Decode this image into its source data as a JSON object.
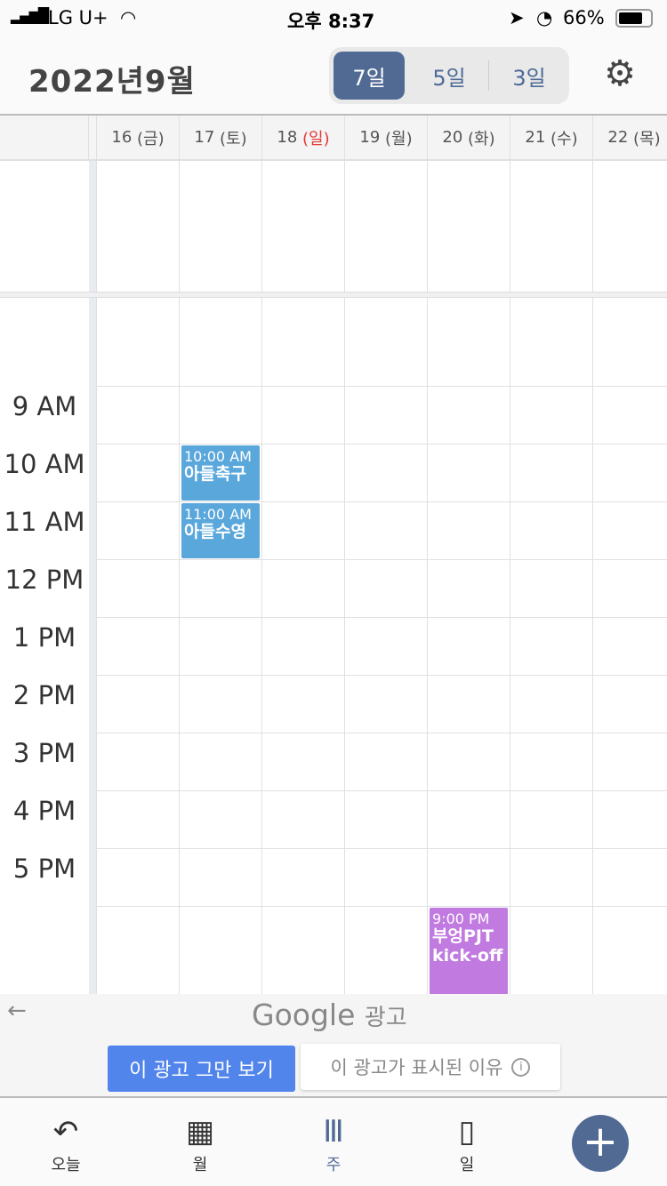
{
  "status_bar": {
    "carrier": "LG U+",
    "time": "오후 8:37",
    "battery": "66%"
  },
  "header": {
    "title": "2022년9월",
    "segments": [
      "7일",
      "5일",
      "3일"
    ],
    "active_segment": "7일",
    "settings_icon": "gear-icon"
  },
  "days": [
    {
      "num": "16",
      "wd": "(금)"
    },
    {
      "num": "17",
      "wd": "(토)"
    },
    {
      "num": "18",
      "wd": "(일)",
      "holiday": true
    },
    {
      "num": "19",
      "wd": "(월)"
    },
    {
      "num": "20",
      "wd": "(화)"
    },
    {
      "num": "21",
      "wd": "(수)"
    },
    {
      "num": "22",
      "wd": "(목)"
    }
  ],
  "time_labels": [
    "9 AM",
    "10 AM",
    "11 AM",
    "12 PM",
    "1 PM",
    "2 PM",
    "3 PM",
    "4 PM",
    "5 PM"
  ],
  "events": [
    {
      "time": "10:00 AM",
      "title": "아들축구",
      "color": "#5aa7dc"
    },
    {
      "time": "11:00 AM",
      "title": "아들수영",
      "color": "#5aa7dc"
    },
    {
      "time": "9:00 PM",
      "title": "부엉PJT kick-off",
      "color": "#c07ae0"
    }
  ],
  "ad": {
    "brand": "Google",
    "label": "광고",
    "stop_button": "이 광고 그만 보기",
    "why_button": "이 광고가 표시된 이유"
  },
  "tabbar": {
    "items": [
      "오늘",
      "월",
      "주",
      "일"
    ],
    "active": "주"
  },
  "colors": {
    "accent": "#506a94",
    "holiday": "#e53935",
    "ad_blue": "#5285ec"
  }
}
